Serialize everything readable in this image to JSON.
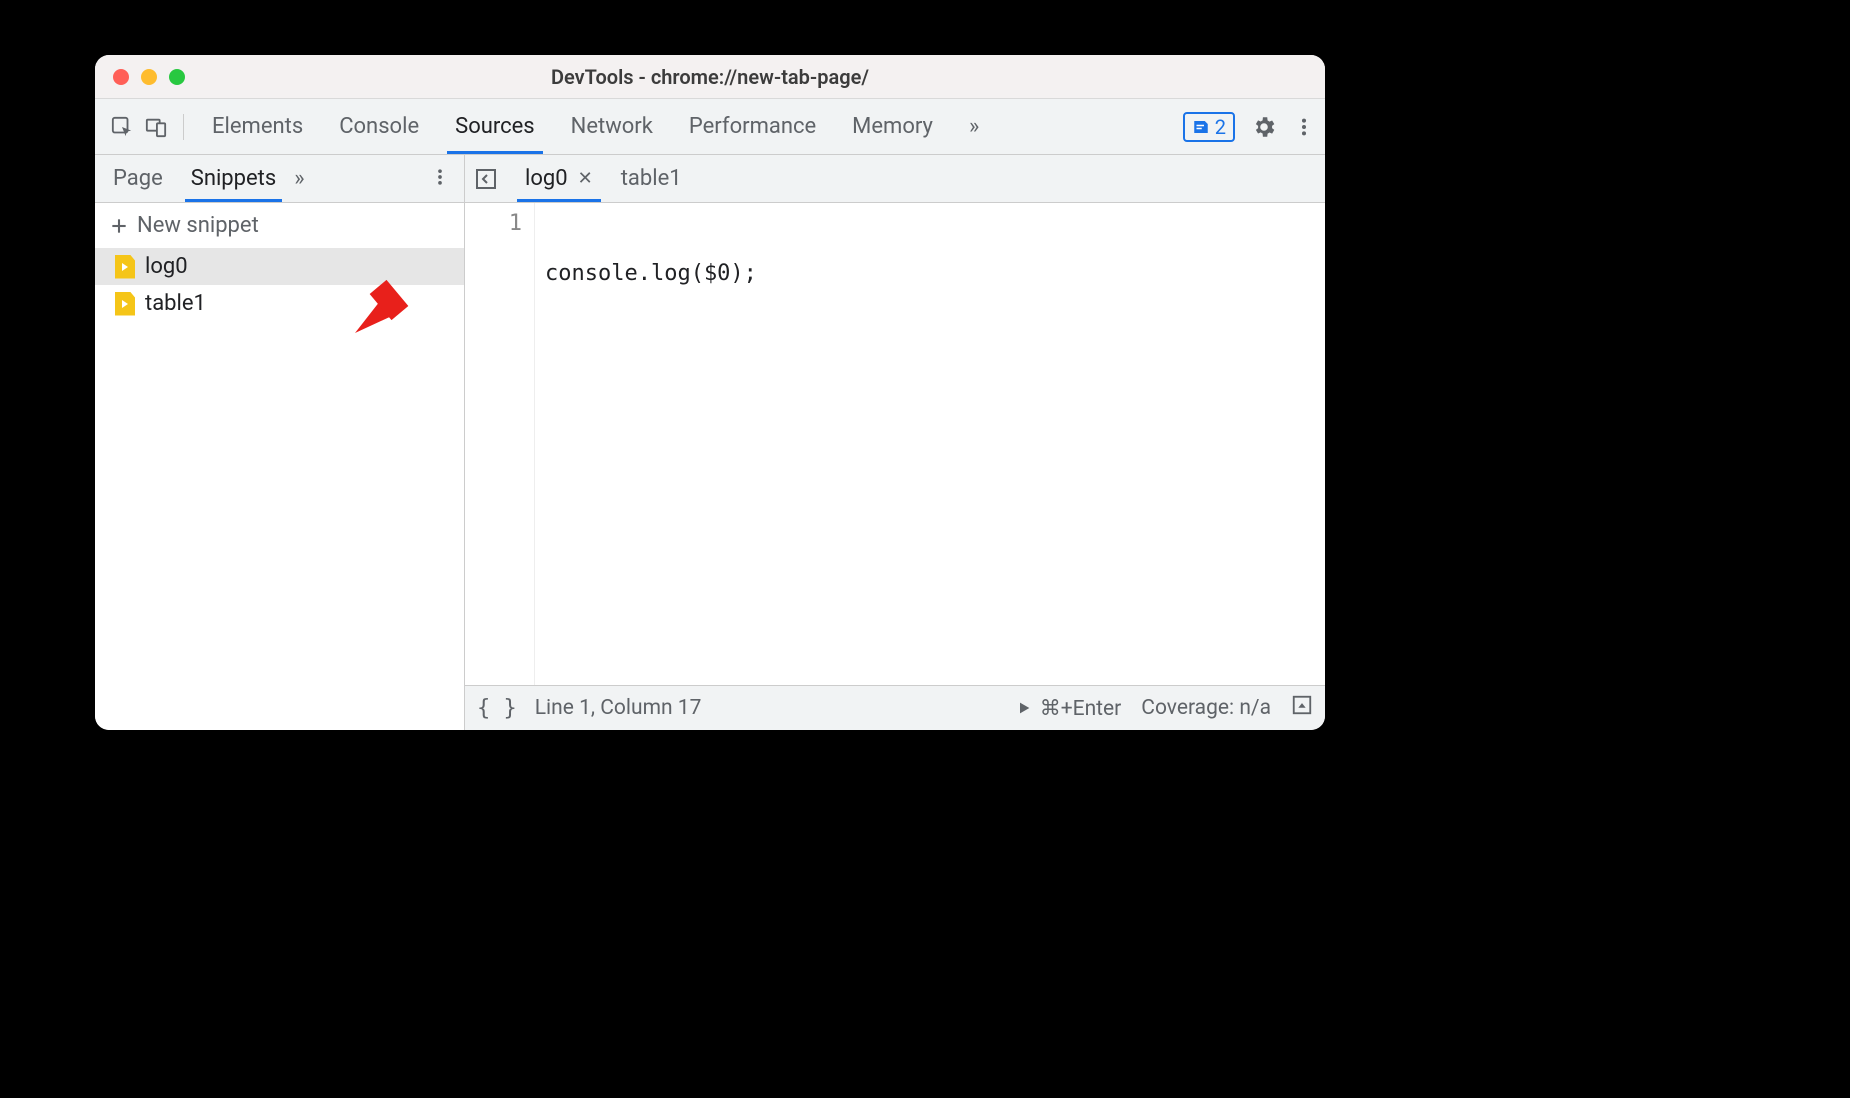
{
  "window": {
    "title": "DevTools - chrome://new-tab-page/"
  },
  "toolbar": {
    "tabs": [
      "Elements",
      "Console",
      "Sources",
      "Network",
      "Performance",
      "Memory"
    ],
    "active_tab": "Sources",
    "overflow": "»",
    "badge_count": "2"
  },
  "sidebar": {
    "tabs": [
      "Page",
      "Snippets"
    ],
    "active_tab": "Snippets",
    "overflow": "»",
    "new_snippet_label": "New snippet",
    "items": [
      {
        "name": "log0",
        "selected": true
      },
      {
        "name": "table1",
        "selected": false
      }
    ]
  },
  "editor": {
    "tabs": [
      {
        "name": "log0",
        "active": true,
        "closeable": true
      },
      {
        "name": "table1",
        "active": false,
        "closeable": false
      }
    ],
    "lines": [
      {
        "n": "1",
        "text": "console.log($0);"
      }
    ]
  },
  "status": {
    "cursor": "Line 1, Column 17",
    "run_shortcut": "⌘+Enter",
    "coverage": "Coverage: n/a"
  }
}
